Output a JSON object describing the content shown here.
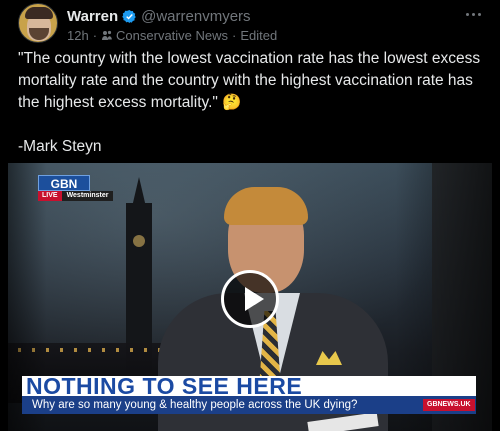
{
  "author": {
    "display_name": "Warren",
    "handle": "@warrenvmyers",
    "verified_color": "#1d9bf0"
  },
  "meta": {
    "time": "12h",
    "separator": "·",
    "community": "Conservative News",
    "edited": "Edited"
  },
  "tweet": {
    "text": "\"The country with the lowest vaccination rate has the lowest excess mortality rate and the country with the highest vaccination rate has the highest excess mortality.\" 🤔\n\n-Mark Steyn"
  },
  "video": {
    "channel_logo": "GBN",
    "live_label": "LIVE",
    "location": "Westminster",
    "headline": "NOTHING TO SEE HERE",
    "subline": "Why are so many young & healthy people across the UK dying?",
    "website": "GBNEWS.UK"
  },
  "colors": {
    "background": "#000000",
    "text_primary": "#e7e9ea",
    "text_secondary": "#71767b",
    "headline_blue": "#1b4aa3"
  },
  "icons": [
    "verified-badge-icon",
    "community-icon",
    "more-options-icon",
    "play-icon"
  ]
}
